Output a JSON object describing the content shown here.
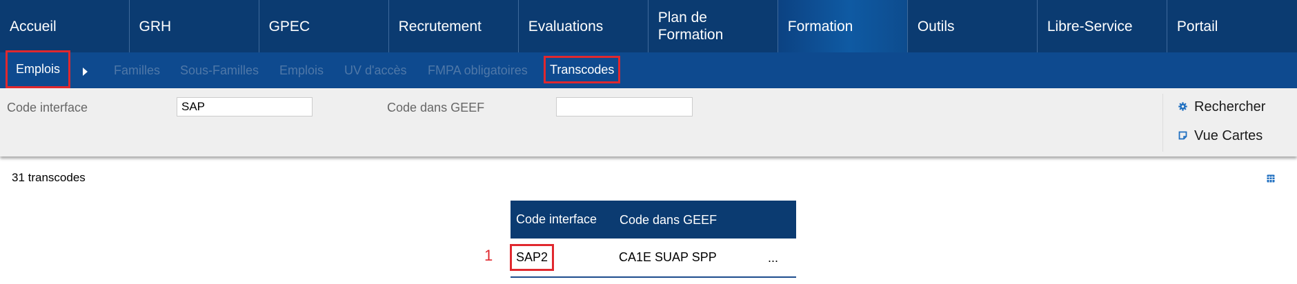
{
  "topnav": {
    "tabs": [
      {
        "label": "Accueil"
      },
      {
        "label": "GRH"
      },
      {
        "label": "GPEC"
      },
      {
        "label": "Recrutement"
      },
      {
        "label": "Evaluations"
      },
      {
        "label": "Plan de\nFormation"
      },
      {
        "label": "Formation"
      },
      {
        "label": "Outils"
      },
      {
        "label": "Libre-Service"
      },
      {
        "label": "Portail"
      }
    ],
    "active": "Formation"
  },
  "subnav": {
    "section": "Emplois",
    "items": [
      "Familles",
      "Sous-Familles",
      "Emplois",
      "UV d'accès",
      "FMPA obligatoires",
      "Transcodes"
    ],
    "current": "Transcodes"
  },
  "filters": {
    "code_interface_label": "Code interface",
    "code_interface_value": "SAP",
    "code_geef_label": "Code dans GEEF",
    "code_geef_value": "",
    "search_label": "Rechercher",
    "cards_label": "Vue Cartes"
  },
  "results": {
    "count_text": "31 transcodes",
    "columns": [
      "Code interface",
      "Code dans GEEF"
    ],
    "rows": [
      {
        "index": "1",
        "code_interface": "SAP2",
        "code_geef": "CA1E SUAP SPP",
        "more": "..."
      }
    ]
  },
  "colors": {
    "nav_dark": "#0b3b71",
    "nav_sub": "#0e4a8f",
    "highlight": "#e0282e",
    "icon_blue": "#1f6fc0"
  }
}
